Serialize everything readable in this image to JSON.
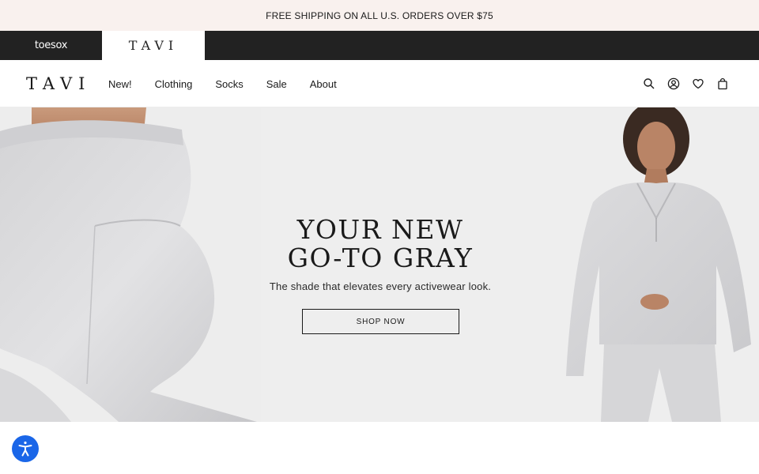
{
  "announcement": {
    "text": "FREE SHIPPING ON ALL U.S. ORDERS OVER $75"
  },
  "brands": [
    {
      "label": "toesox",
      "active": false
    },
    {
      "label": "TAVI",
      "active": true
    }
  ],
  "header": {
    "logo": "TAVI",
    "nav": [
      "New!",
      "Clothing",
      "Socks",
      "Sale",
      "About"
    ],
    "icons": [
      "search-icon",
      "account-icon",
      "heart-icon",
      "bag-icon"
    ]
  },
  "hero": {
    "headline_line1": "YOUR NEW",
    "headline_line2": "GO-TO GRAY",
    "subline": "The shade that elevates every activewear look.",
    "cta_label": "SHOP NOW"
  },
  "colors": {
    "announcement_bg": "#f9f1ee",
    "brandbar_bg": "#222222",
    "hero_bg": "#eeeeee",
    "accessibility_blue": "#1a66e8"
  }
}
